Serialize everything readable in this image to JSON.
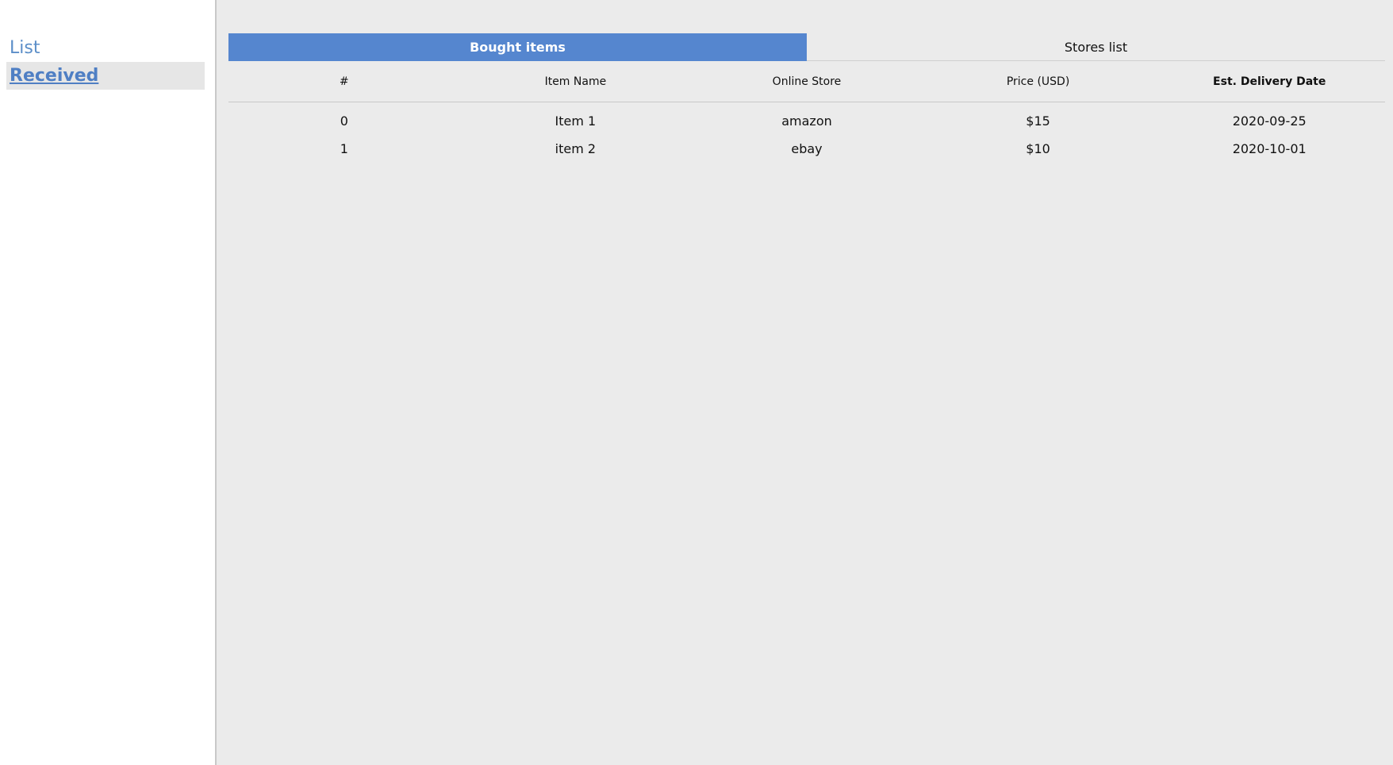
{
  "sidebar": {
    "items": [
      {
        "label": "List"
      },
      {
        "label": "Received"
      }
    ]
  },
  "tabs": [
    {
      "label": "Bought items"
    },
    {
      "label": "Stores list"
    }
  ],
  "table": {
    "headers": [
      "#",
      "Item Name",
      "Online Store",
      "Price (USD)",
      "Est. Delivery Date"
    ],
    "rows": [
      [
        "0",
        "Item 1",
        "amazon",
        "$15",
        "2020-09-25"
      ],
      [
        "1",
        "item 2",
        "ebay",
        "$10",
        "2020-10-01"
      ]
    ]
  },
  "colors": {
    "active_tab": "#5586cf",
    "nav_link": "#5b8ec8",
    "main_background": "#ebebeb"
  }
}
